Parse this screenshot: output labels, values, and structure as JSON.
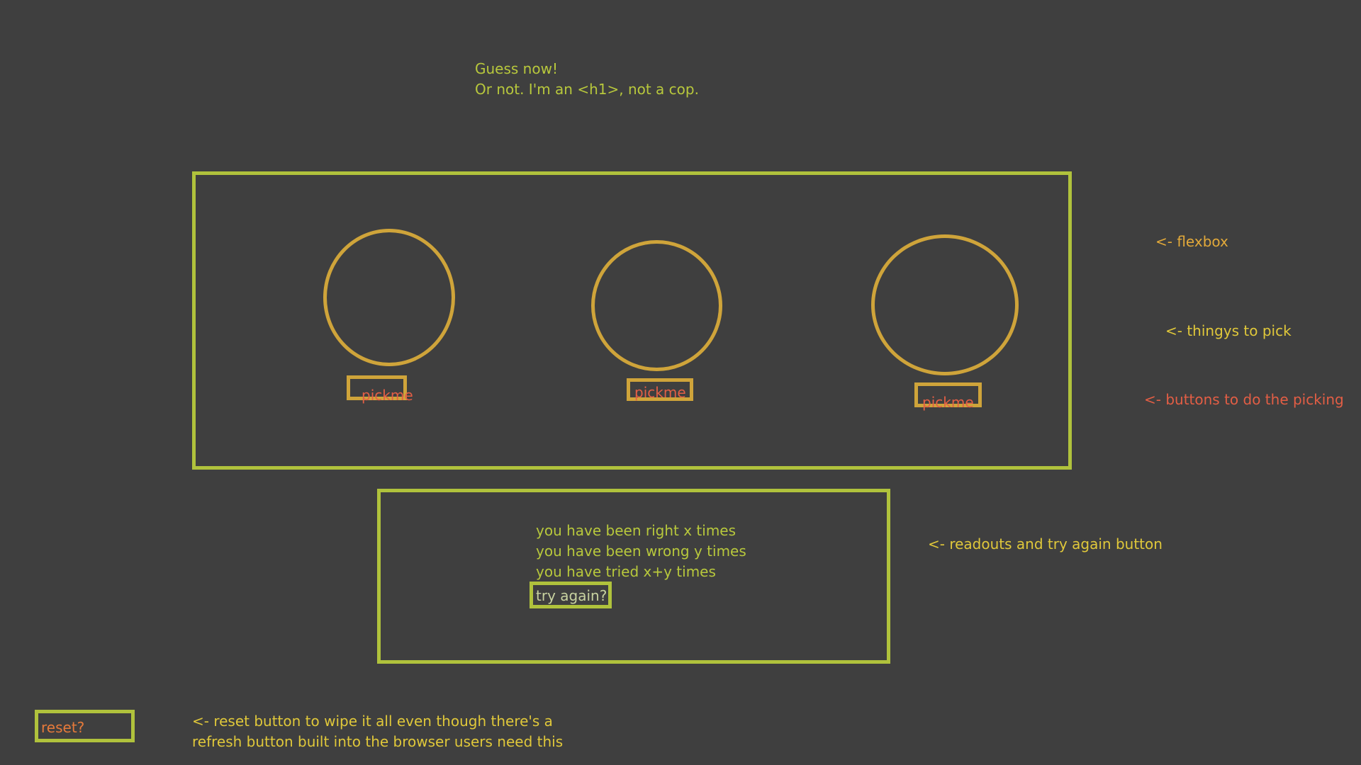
{
  "header": {
    "line1": "Guess now!",
    "line2": "Or not. I'm an <h1>, not a cop."
  },
  "pick_buttons": [
    "pickme",
    "pickme",
    "pickme"
  ],
  "readouts": {
    "right": "you have been right x times",
    "wrong": "you have been wrong y times",
    "tried": "you have tried x+y times",
    "try_again": "try again?"
  },
  "reset": {
    "label": "reset?"
  },
  "annotations": {
    "flexbox": "<- flexbox",
    "thingys": "<- thingys to pick",
    "buttons": "<- buttons to do the picking",
    "readouts": "<- readouts and try again button",
    "reset_line1": "<- reset button to wipe it all even though there's a",
    "reset_line2": "refresh button built into the browser users need this"
  },
  "colors": {
    "background": "#3f3f3f",
    "box_border": "#b0c23c",
    "circle_border": "#cfa43a",
    "heading_text": "#b8c83c",
    "button_text": "#e35e45"
  }
}
